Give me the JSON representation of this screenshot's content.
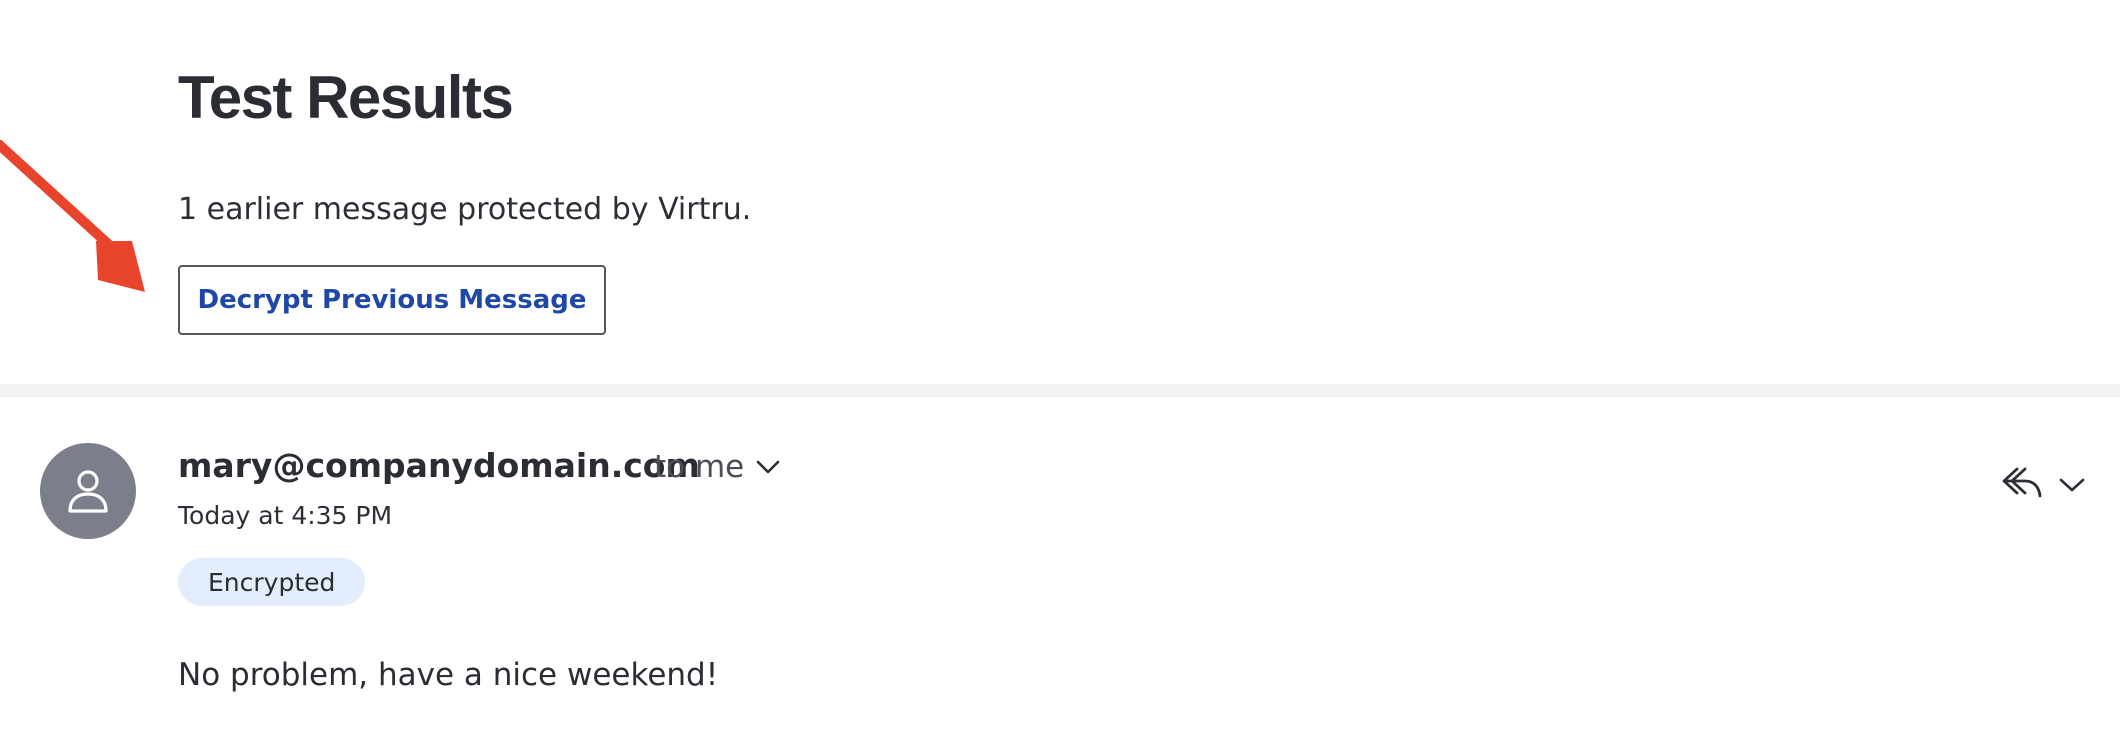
{
  "email": {
    "subject": "Test Results",
    "earlier_notice": "1 earlier message protected by Virtru.",
    "decrypt_button_label": "Decrypt Previous Message",
    "message": {
      "sender": "mary@companydomain.com",
      "recipient_label": "to me",
      "timestamp": "Today at 4:35 PM",
      "badge": "Encrypted",
      "body": "No problem, have a nice weekend!"
    }
  },
  "icons": {
    "annotation": "arrow-icon",
    "avatar": "person-icon",
    "recipient_toggle": "chevron-down-icon",
    "reply": "reply-icon",
    "more": "chevron-down-icon"
  },
  "colors": {
    "annotation_arrow": "#e8432b",
    "button_text": "#1f47a8",
    "badge_background": "#e3edfb",
    "avatar_background": "#7a7f8b",
    "divider": "#f2f2f3"
  }
}
